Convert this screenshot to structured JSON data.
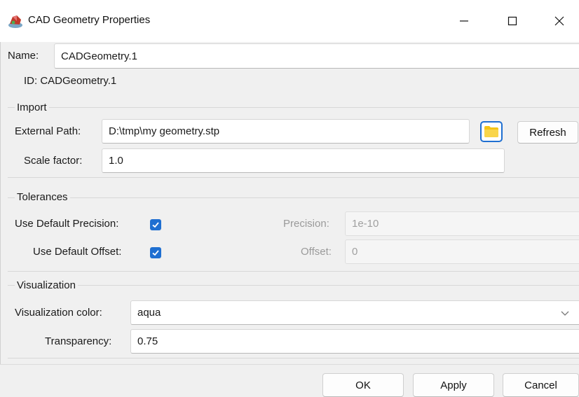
{
  "window": {
    "title": "CAD Geometry Properties",
    "icon": "cad-geometry-icon"
  },
  "name": {
    "label": "Name:",
    "value": "CADGeometry.1"
  },
  "id": {
    "text": "ID: CADGeometry.1"
  },
  "import": {
    "title": "Import",
    "external_path_label": "External Path:",
    "external_path_value": "D:\\tmp\\my geometry.stp",
    "refresh_label": "Refresh",
    "scale_factor_label": "Scale factor:",
    "scale_factor_value": "1.0"
  },
  "tolerances": {
    "title": "Tolerances",
    "use_default_precision_label": "Use Default Precision:",
    "use_default_precision_checked": true,
    "precision_label": "Precision:",
    "precision_value": "1e-10",
    "use_default_offset_label": "Use Default Offset:",
    "use_default_offset_checked": true,
    "offset_label": "Offset:",
    "offset_value": "0"
  },
  "visualization": {
    "title": "Visualization",
    "color_label": "Visualization color:",
    "color_value": "aqua",
    "transparency_label": "Transparency:",
    "transparency_value": "0.75"
  },
  "buttons": {
    "ok": "OK",
    "apply": "Apply",
    "cancel": "Cancel"
  },
  "colors": {
    "accent": "#1f6fd1",
    "folder": "#f5c518"
  }
}
